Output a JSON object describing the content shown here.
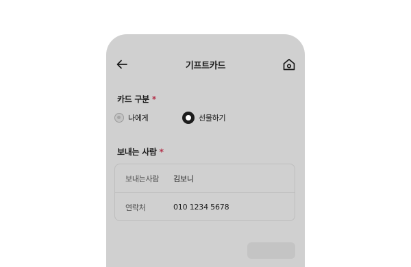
{
  "header": {
    "title": "기프트카드",
    "back_icon": "arrow-left-icon",
    "home_icon": "home-icon"
  },
  "card_type": {
    "label": "카드 구분",
    "required_mark": "*",
    "options": [
      {
        "label": "나에게",
        "selected": false
      },
      {
        "label": "선물하기",
        "selected": true
      }
    ]
  },
  "sender": {
    "label": "보내는 사람",
    "required_mark": "*",
    "rows": [
      {
        "label": "보내는사람",
        "value": "김보니"
      },
      {
        "label": "연락처",
        "value": "010 1234 5678"
      }
    ]
  },
  "colors": {
    "sheet_bg": "#d0d0d0",
    "required": "#b3314a",
    "radio_selected": "#1c1c1c"
  }
}
